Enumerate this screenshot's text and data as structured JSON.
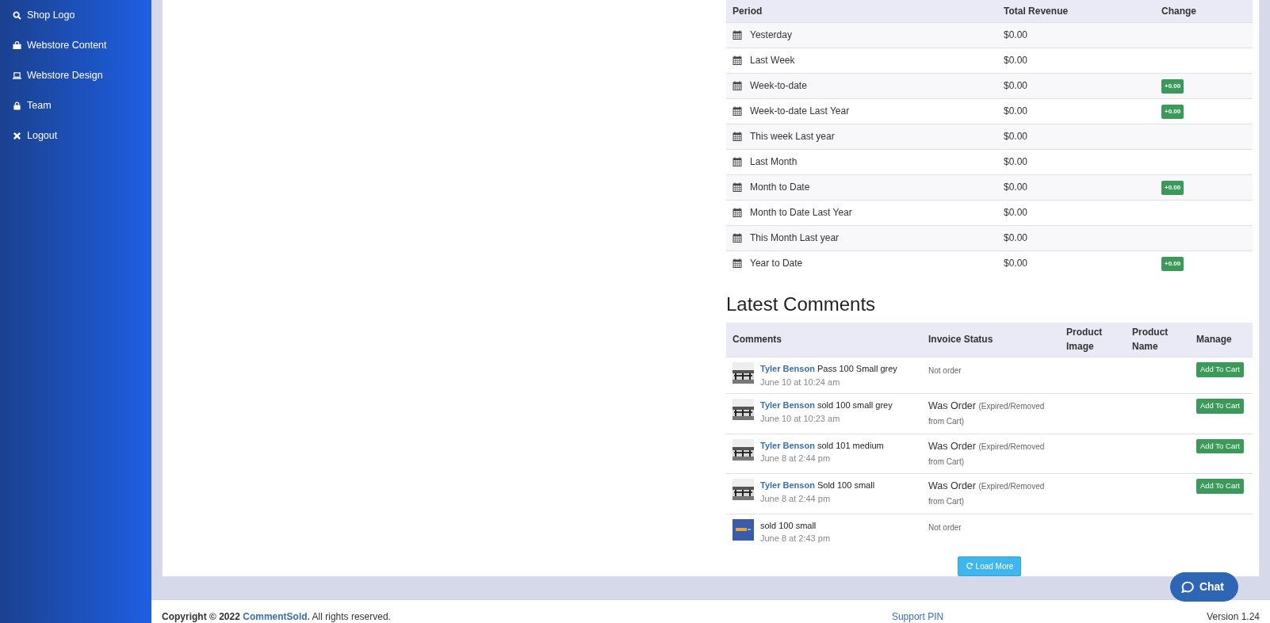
{
  "sidebar": {
    "items": [
      {
        "label": "Shop Logo"
      },
      {
        "label": "Webstore Content"
      },
      {
        "label": "Webstore Design"
      },
      {
        "label": "Team"
      },
      {
        "label": "Logout"
      }
    ]
  },
  "revenue_table": {
    "columns": [
      "Period",
      "Total Revenue",
      "Change"
    ],
    "rows": [
      {
        "period": "Yesterday",
        "revenue": "$0.00"
      },
      {
        "period": "Last Week",
        "revenue": "$0.00"
      },
      {
        "period": "Week-to-date",
        "revenue": "$0.00",
        "change": "+0.00"
      },
      {
        "period": "Week-to-date Last Year",
        "revenue": "$0.00",
        "change": "+0.00"
      },
      {
        "period": "This week Last year",
        "revenue": "$0.00"
      },
      {
        "period": "Last Month",
        "revenue": "$0.00"
      },
      {
        "period": "Month to Date",
        "revenue": "$0.00",
        "change": "+0.00"
      },
      {
        "period": "Month to Date Last Year",
        "revenue": "$0.00"
      },
      {
        "period": "This Month Last year",
        "revenue": "$0.00"
      },
      {
        "period": "Year to Date",
        "revenue": "$0.00",
        "change": "+0.00"
      }
    ]
  },
  "comments": {
    "title": "Latest Comments",
    "columns": [
      "Comments",
      "Invoice Status",
      "Product Image",
      "Product Name",
      "Manage"
    ],
    "rows": [
      {
        "author": "Tyler Benson",
        "text": "Pass 100 Small grey",
        "time": "June 10 at 10:24 am",
        "status": {
          "kind": "plain",
          "text": "Not order"
        },
        "button": "Add To Cart"
      },
      {
        "author": "Tyler Benson",
        "text": "sold 100 small grey",
        "time": "June 10 at 10:23 am",
        "status": {
          "kind": "order",
          "text": "Was Order",
          "note": "(Expired/Removed from Cart)"
        },
        "button": "Add To Cart"
      },
      {
        "author": "Tyler Benson",
        "text": "sold 101 medium",
        "time": "June 8 at 2:44 pm",
        "status": {
          "kind": "order",
          "text": "Was Order",
          "note": "(Expired/Removed from Cart)"
        },
        "button": "Add To Cart"
      },
      {
        "author": "Tyler Benson",
        "text": "Sold 100 small",
        "time": "June 8 at 2:44 pm",
        "status": {
          "kind": "order",
          "text": "Was Order",
          "note": "(Expired/Removed from Cart)"
        },
        "button": "Add To Cart"
      },
      {
        "comment": "sold 100 small",
        "time": "June 8 at 2:43 pm",
        "status": {
          "kind": "plain",
          "text": "Not order"
        }
      }
    ],
    "load_more": "Load More"
  },
  "footer": {
    "copyright": "**Copyright © 2022**",
    "link": "CommentSold.",
    "rights": "All rights reserved.",
    "support": "Support PIN",
    "version": "Version 1.24"
  },
  "chat": {
    "label": "Chat"
  }
}
